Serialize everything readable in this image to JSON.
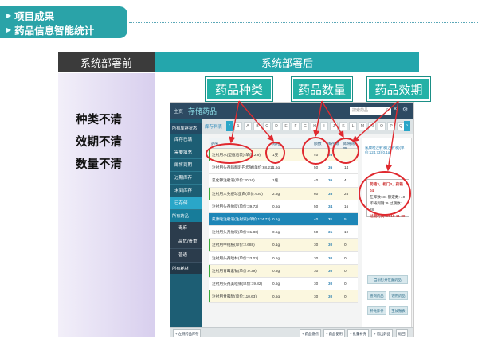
{
  "slide": {
    "title_line1": "项目成果",
    "title_line2": "药品信息智能统计",
    "col_before": "系统部署前",
    "col_after": "系统部署后",
    "issues": [
      "种类不清",
      "效期不清",
      "数量不清"
    ],
    "tags": [
      "药品种类",
      "药品数量",
      "药品效期"
    ]
  },
  "app": {
    "top": {
      "main": "主页",
      "section": "存储药品",
      "search_placeholder": "搜索药品",
      "close": "×",
      "search_icon": "search-icon",
      "gear_icon": "gear-icon"
    },
    "sidebar": {
      "category": "所有库存状态",
      "items": [
        "库存已满",
        "需要填充",
        "即将到期",
        "过期库存",
        "未到库存",
        "已存储"
      ],
      "category2": "所有药品",
      "subitems": [
        "毒麻",
        "高危/贵重",
        "普通"
      ],
      "footer": "所有耗材"
    },
    "list_label": "库存列表",
    "letters": [
      "1",
      "A",
      "B",
      "C",
      "D",
      "E",
      "F",
      "G",
      "H",
      "I",
      "J",
      "K",
      "L",
      "M",
      "N",
      "O",
      "P",
      "Q"
    ],
    "columns": {
      "name": "药名",
      "spec": "规格",
      "cap": "额数",
      "stock": "库存数",
      "exp": "即将效期"
    },
    "rows": [
      {
        "name": "注射用水(塑瓶包装)(单价:2.9)",
        "spec": "1支",
        "cap": "40",
        "stock": "36",
        "exp": "",
        "style": "alt",
        "bar": true
      },
      {
        "name": "注射用头孢哌酮舒巴坦钠(单价:68.21)",
        "spec": "1.5g",
        "cap": "50",
        "stock": "36",
        "exp": "14",
        "style": "",
        "bar": false
      },
      {
        "name": "氯化钾注射液(单价:20.16)",
        "spec": "1瓶",
        "cap": "40",
        "stock": "36",
        "exp": "4",
        "style": "",
        "bar": false
      },
      {
        "name": "注射用人免疫球蛋白(单价:630)",
        "spec": "2.5g",
        "cap": "60",
        "stock": "35",
        "exp": "25",
        "style": "alt",
        "bar": true
      },
      {
        "name": "注射用头孢他啶(单价:39.72)",
        "spec": "0.5g",
        "cap": "50",
        "stock": "34",
        "exp": "16",
        "style": "",
        "bar": false
      },
      {
        "name": "氟康唑注射液(注射液)(单价:124.73)",
        "spec": "0.1g",
        "cap": "40",
        "stock": "31",
        "exp": "5",
        "style": "sel",
        "bar": false
      },
      {
        "name": "注射用头孢他啶(单价:31.86)",
        "spec": "0.5g",
        "cap": "50",
        "stock": "31",
        "exp": "19",
        "style": "",
        "bar": false
      },
      {
        "name": "注射用甲钴胺(单价:2.688)",
        "spec": "0.1g",
        "cap": "30",
        "stock": "30",
        "exp": "0",
        "style": "alt",
        "bar": true
      },
      {
        "name": "注射用头孢唑林(单价:33.02)",
        "spec": "0.5g",
        "cap": "30",
        "stock": "30",
        "exp": "0",
        "style": "",
        "bar": false
      },
      {
        "name": "注射用青霉素钠(单价:0.39)",
        "spec": "0.5g",
        "cap": "30",
        "stock": "30",
        "exp": "0",
        "style": "alt",
        "bar": true
      },
      {
        "name": "注射用头孢美唑钠(单价:19.82)",
        "spec": "0.5g",
        "cap": "30",
        "stock": "30",
        "exp": "0",
        "style": "",
        "bar": false
      },
      {
        "name": "注射用甘露醇(单价:110.63)",
        "spec": "0.5g",
        "cap": "30",
        "stock": "30",
        "exp": "0",
        "style": "alt",
        "bar": true
      }
    ],
    "detail": {
      "heading": "氟康唑注射液(注射液)(单价:124.73)(0.1g)",
      "location": "药箱3，柜门3，药箱04",
      "stock_line": "在库数: 31  额定数: 40",
      "near_line": "即将到期: 9  过期数: 28",
      "expiry_line": "过期时间: 2018-11-30",
      "buttons": [
        "当前打开位置药品",
        "查询药品",
        "领用药品",
        "补充库存",
        "生成报表"
      ]
    },
    "bottom": {
      "left": "+ 左侧药品库存",
      "b1": "+ 药品盘点",
      "b2": "+ 药品使用",
      "b3": "+ 批量补充",
      "b4": "+ 借出药品",
      "exit": "返回"
    }
  }
}
